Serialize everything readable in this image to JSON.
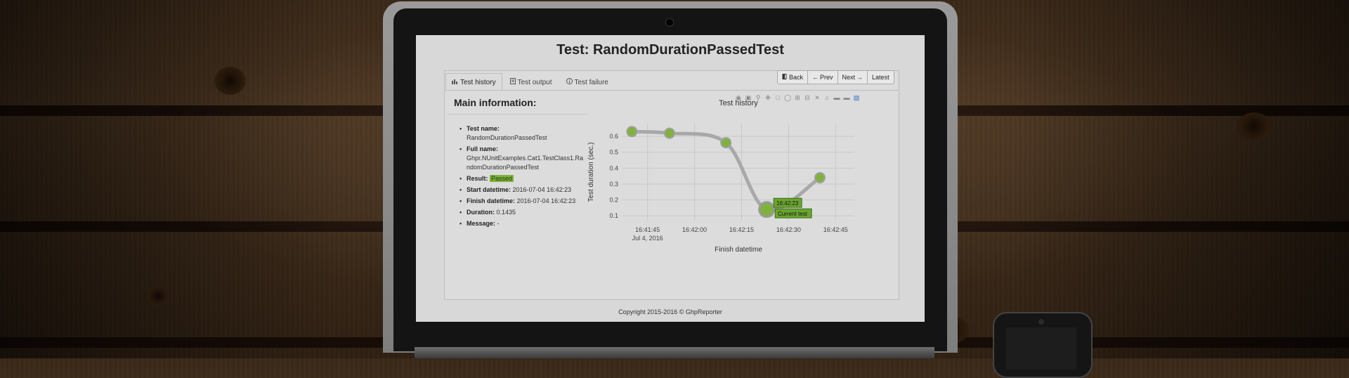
{
  "page": {
    "title": "Test: RandomDurationPassedTest",
    "footer": "Copyright 2015-2016 © GhpReporter"
  },
  "tabs": [
    {
      "label": "Test history",
      "icon": "bar-chart-icon",
      "active": true
    },
    {
      "label": "Test output",
      "icon": "document-icon",
      "active": false
    },
    {
      "label": "Test failure",
      "icon": "info-circle-icon",
      "active": false
    }
  ],
  "nav": {
    "back": "Back",
    "prev": "Prev",
    "next": "Next",
    "latest": "Latest"
  },
  "main_info": {
    "heading": "Main information:",
    "test_name_label": "Test name:",
    "test_name": "RandomDurationPassedTest",
    "full_name_label": "Full name:",
    "full_name_line1": "Ghpr.NUnitExamples.Cat1.TestClass1.Ra",
    "full_name_line2": "ndomDurationPassedTest",
    "result_label": "Result:",
    "result": "Passed",
    "start_label": "Start datetime:",
    "start": "2016-07-04 16:42:23",
    "finish_label": "Finish datetime:",
    "finish": "2016-07-04 16:42:23",
    "duration_label": "Duration:",
    "duration": "0.1435",
    "message_label": "Message:",
    "message": "-"
  },
  "modebar_icons": [
    "camera-icon",
    "save-icon",
    "zoom-icon",
    "pan-icon",
    "box-select-icon",
    "lasso-icon",
    "zoom-in-icon",
    "zoom-out-icon",
    "autoscale-icon",
    "home-icon",
    "hover-closest-icon",
    "hover-compare-icon",
    "plotly-logo-icon"
  ],
  "colors": {
    "accent_green": "#7fb23c",
    "line_gray": "#a8a8a8",
    "tooltip_green": "#6aa52c"
  },
  "chart_data": {
    "type": "line",
    "title": "Test history",
    "xlabel": "Finish datetime",
    "ylabel": "Test duration (sec.)",
    "x": [
      "16:41:40",
      "16:41:52",
      "16:42:10",
      "16:42:23",
      "16:42:40"
    ],
    "y": [
      0.63,
      0.62,
      0.56,
      0.14,
      0.34
    ],
    "x_ticks": [
      "16:41:45",
      "16:42:00",
      "16:42:15",
      "16:42:30",
      "16:42:45"
    ],
    "x_tick_sub": "Jul 4, 2016",
    "y_ticks": [
      "0.1",
      "0.2",
      "0.3",
      "0.4",
      "0.5",
      "0.6"
    ],
    "ylim": [
      0.07,
      0.68
    ],
    "grid": true,
    "highlight": {
      "index": 3,
      "time_label": "16:42:23",
      "note": "Current test"
    }
  }
}
